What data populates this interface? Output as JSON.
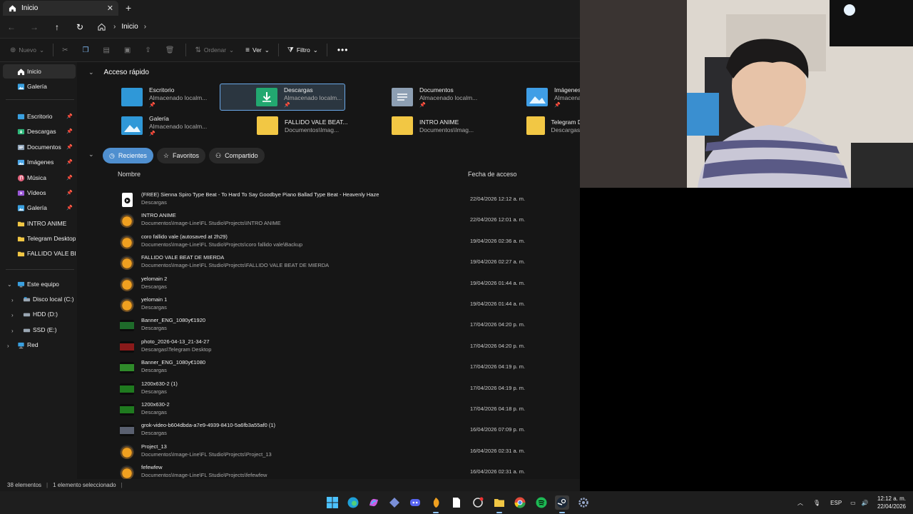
{
  "window": {
    "tab_title": "Inicio",
    "tab_close": "✕",
    "new_tab": "+"
  },
  "address": {
    "crumb": "Inicio"
  },
  "toolbar": {
    "new_label": "Nuevo",
    "sort_label": "Ordenar",
    "view_label": "Ver",
    "filter_label": "Filtro",
    "more_label": "•••"
  },
  "sidebar": {
    "top": [
      {
        "label": "Inicio",
        "icon": "home-icon"
      },
      {
        "label": "Galería",
        "icon": "gallery-icon"
      }
    ],
    "pinned": [
      {
        "label": "Escritorio",
        "icon": "desktop-folder-icon",
        "color": "#3aa0e0"
      },
      {
        "label": "Descargas",
        "icon": "downloads-folder-icon",
        "color": "#2fb87a"
      },
      {
        "label": "Documentos",
        "icon": "documents-folder-icon",
        "color": "#8ea3b8"
      },
      {
        "label": "Imágenes",
        "icon": "pictures-folder-icon",
        "color": "#4aa6e8"
      },
      {
        "label": "Música",
        "icon": "music-folder-icon",
        "color": "#e0607a"
      },
      {
        "label": "Vídeos",
        "icon": "videos-folder-icon",
        "color": "#9b58d8"
      },
      {
        "label": "Galería",
        "icon": "gallery-icon",
        "color": "#3aa0e0"
      }
    ],
    "folders": [
      {
        "label": "INTRO ANIME"
      },
      {
        "label": "Telegram Desktop"
      },
      {
        "label": "FALLIDO VALE BEAT"
      }
    ],
    "tree": [
      {
        "label": "Este equipo",
        "icon": "pc-icon"
      },
      {
        "label": "Disco local (C:)",
        "icon": "drive-icon"
      },
      {
        "label": "HDD (D:)",
        "icon": "drive-icon"
      },
      {
        "label": "SSD (E:)",
        "icon": "drive-icon"
      },
      {
        "label": "Red",
        "icon": "network-icon"
      }
    ]
  },
  "quick_access": {
    "title": "Acceso rápido",
    "items": [
      {
        "name": "Escritorio",
        "sub": "Almacenado localm...",
        "color": "#2f98d8"
      },
      {
        "name": "Descargas",
        "sub": "Almacenado localm...",
        "color": "#22a870",
        "selected": true
      },
      {
        "name": "Documentos",
        "sub": "Almacenado localm...",
        "color": "#8d9fb3"
      },
      {
        "name": "Imágenes",
        "sub": "Almacenado",
        "color": "#3f9ee6"
      },
      {
        "name": "Galería",
        "sub": "Almacenado localm...",
        "color": "#2f98d8"
      },
      {
        "name": "FALLIDO VALE BEAT...",
        "sub": "Documentos\\Imag...",
        "color": "#f2c744"
      },
      {
        "name": "INTRO ANIME",
        "sub": "Documentos\\Imag...",
        "color": "#f2c744"
      },
      {
        "name": "Telegram D",
        "sub": "Descargas",
        "color": "#f2c744"
      }
    ]
  },
  "recent": {
    "tabs": [
      "Recientes",
      "Favoritos",
      "Compartido"
    ],
    "col_name": "Nombre",
    "col_date": "Fecha de acceso",
    "files": [
      {
        "name": "(FREE) Sienna Spiro Type Beat - To Hard To Say Goodbye  Piano Ballad Type Beat - Heavenly Haze",
        "path": "Descargas",
        "date": "22/04/2026 12:12 a. m.",
        "icon": "media-file-icon",
        "color": "#ffffff"
      },
      {
        "name": "INTRO ANIME",
        "path": "Documentos\\Image-Line\\FL Studio\\Projects\\INTRO ANIME",
        "date": "22/04/2026 12:01 a. m.",
        "icon": "fl-studio-icon",
        "color": "#f0a020"
      },
      {
        "name": "coro fallido vale (autosaved at 2h29)",
        "path": "Documentos\\Image-Line\\FL Studio\\Projects\\coro fallido vale\\Backup",
        "date": "19/04/2026 02:36 a. m.",
        "icon": "fl-studio-icon",
        "color": "#f0a020"
      },
      {
        "name": "FALLIDO VALE BEAT DE MIERDA",
        "path": "Documentos\\Image-Line\\FL Studio\\Projects\\FALLIDO VALE BEAT DE MIERDA",
        "date": "19/04/2026 02:27 a. m.",
        "icon": "fl-studio-icon",
        "color": "#f0a020"
      },
      {
        "name": "yelomain 2",
        "path": "Descargas",
        "date": "19/04/2026 01:44 a. m.",
        "icon": "fl-studio-icon",
        "color": "#f0a020"
      },
      {
        "name": "yelomain 1",
        "path": "Descargas",
        "date": "19/04/2026 01:44 a. m.",
        "icon": "fl-studio-icon",
        "color": "#f0a020"
      },
      {
        "name": "Banner_ENG_1080y€1920",
        "path": "Descargas",
        "date": "17/04/2026 04:20 p. m.",
        "icon": "image-thumb-icon",
        "color": "#1e6b2a"
      },
      {
        "name": "photo_2026-04-13_21-34-27",
        "path": "Descargas\\Telegram Desktop",
        "date": "17/04/2026 04:20 p. m.",
        "icon": "image-thumb-icon",
        "color": "#8a1a1a"
      },
      {
        "name": "Banner_ENG_1080y€1080",
        "path": "Descargas",
        "date": "17/04/2026 04:19 p. m.",
        "icon": "image-thumb-icon",
        "color": "#2f8a2a"
      },
      {
        "name": "1200x630-2 (1)",
        "path": "Descargas",
        "date": "17/04/2026 04:19 p. m.",
        "icon": "image-thumb-icon",
        "color": "#1f7a1f"
      },
      {
        "name": "1200x630-2",
        "path": "Descargas",
        "date": "17/04/2026 04:18 p. m.",
        "icon": "image-thumb-icon",
        "color": "#1f7a1f"
      },
      {
        "name": "grok-video-b604dbda-a7e9-4939-8410-5a6fb3a55af0 (1)",
        "path": "Descargas",
        "date": "16/04/2026 07:09 p. m.",
        "icon": "video-thumb-icon",
        "color": "#5a6070"
      },
      {
        "name": "Project_13",
        "path": "Documentos\\Image-Line\\FL Studio\\Projects\\Project_13",
        "date": "16/04/2026 02:31 a. m.",
        "icon": "fl-studio-icon",
        "color": "#f0a020"
      },
      {
        "name": "fefewfew",
        "path": "Documentos\\Image-Line\\FL Studio\\Projects\\fefewfew",
        "date": "16/04/2026 02:31 a. m.",
        "icon": "fl-studio-icon",
        "color": "#f0a020"
      }
    ]
  },
  "status": {
    "count": "38 elementos",
    "selected": "1 elemento seleccionado"
  },
  "taskbar": {
    "icons": [
      "windows-start-icon",
      "edge-icon",
      "copilot-icon",
      "app-icon",
      "discord-icon",
      "fl-studio-icon",
      "file-icon",
      "notification-app-icon",
      "file-explorer-icon",
      "chrome-icon",
      "spotify-icon",
      "steam-icon",
      "settings-icon"
    ],
    "lang": "ESP",
    "time": "12:12 a. m.",
    "date": "22/04/2026"
  }
}
